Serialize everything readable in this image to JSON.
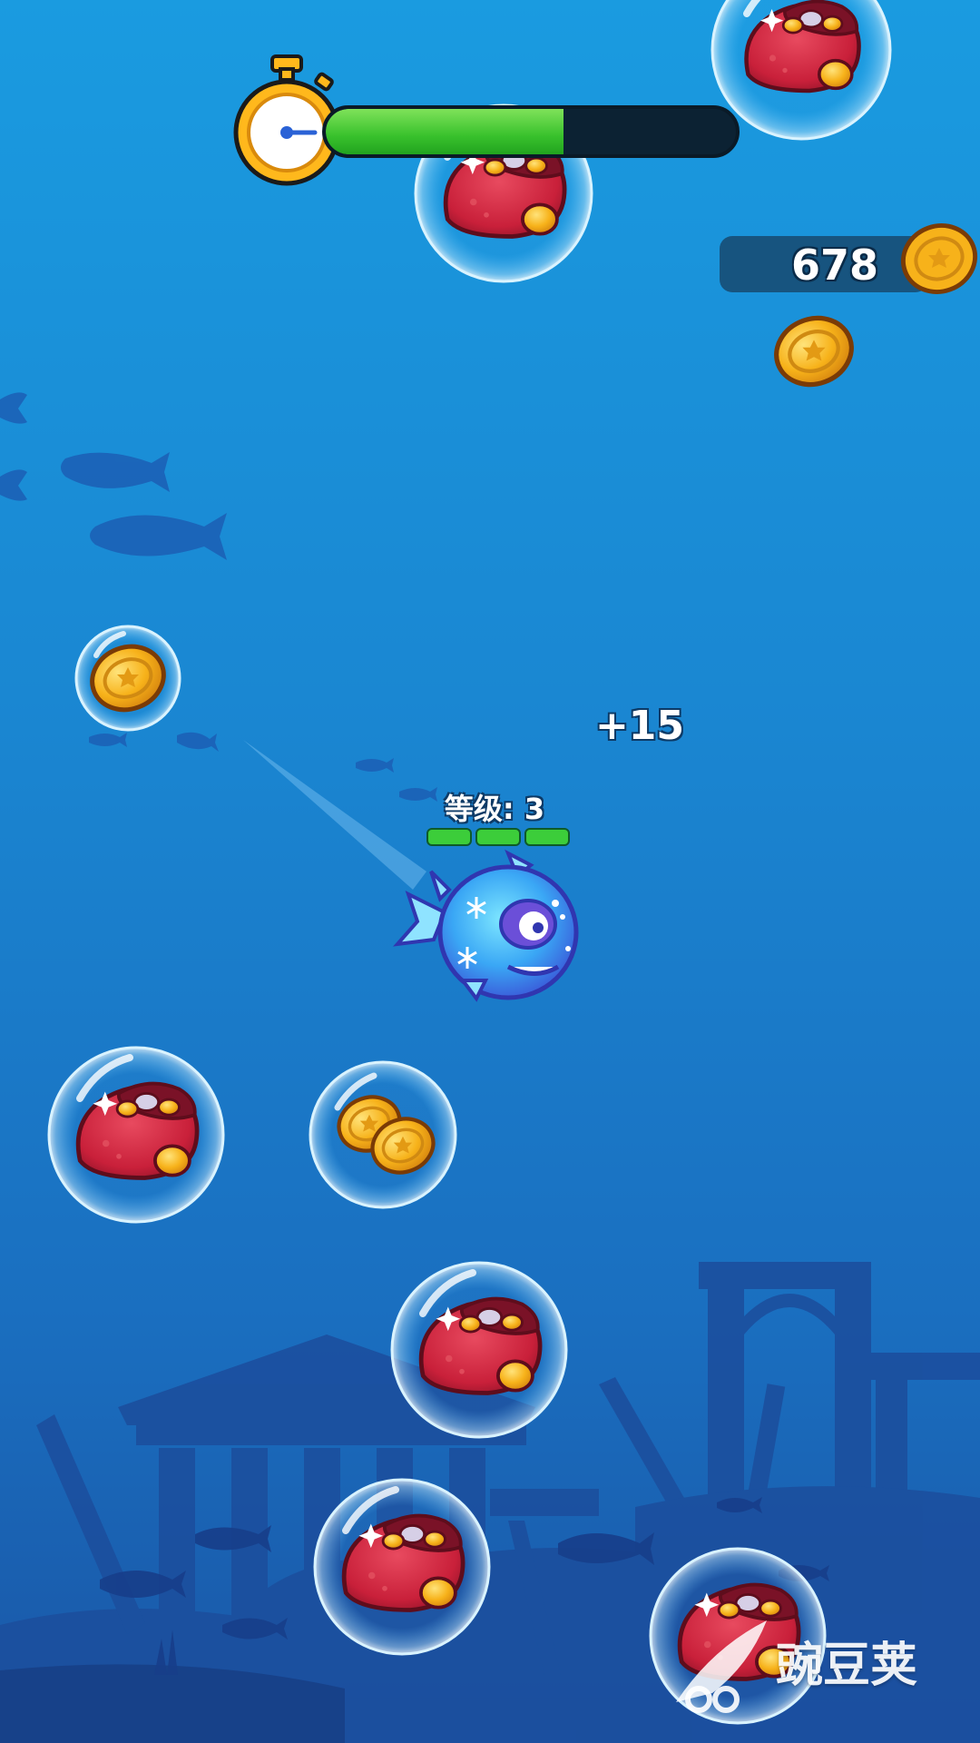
{
  "hud": {
    "timer": {
      "icon": "stopwatch-icon",
      "remaining_fraction": 0.58
    },
    "coins": {
      "count": "678",
      "icon": "gold-coin-icon"
    }
  },
  "player": {
    "level_label": "等级: 3",
    "level_bar_segments_filled": 3,
    "level_bar_segments_total": 3
  },
  "popup": {
    "score_gain": "+15"
  },
  "bubbles": [
    {
      "contents": "treasure-pouch"
    },
    {
      "contents": "treasure-pouch"
    },
    {
      "contents": "coin"
    },
    {
      "contents": "treasure-pouch"
    },
    {
      "contents": "coin-stack"
    },
    {
      "contents": "treasure-pouch"
    },
    {
      "contents": "treasure-pouch"
    },
    {
      "contents": "treasure-pouch"
    }
  ],
  "watermark": {
    "text": "豌豆荚"
  },
  "colors": {
    "sea_top": "#1a9be0",
    "sea_bottom": "#1a56a6",
    "timer_fill": "#38c12c",
    "coin_gold": "#f7b21a",
    "pouch_red": "#c9203a"
  }
}
